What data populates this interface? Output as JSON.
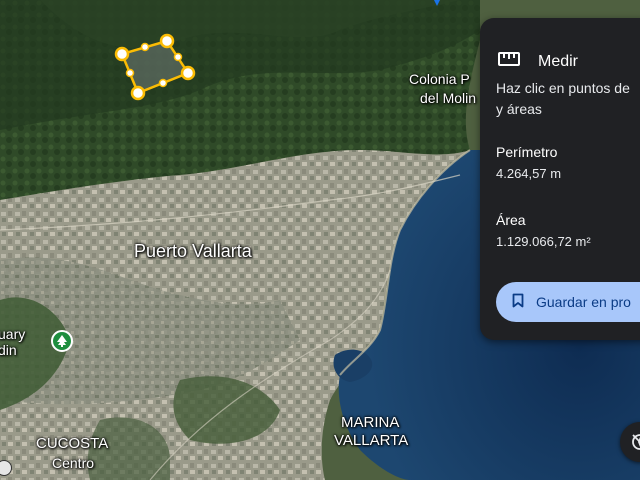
{
  "map": {
    "labels": {
      "city": "Puerto Vallarta",
      "colonia_line1": "Colonia P",
      "colonia_line2": "del Molin",
      "marina_line1": "MARINA",
      "marina_line2": "VALLARTA",
      "cucosta": "CUCOSTA",
      "centro": "Centro",
      "park_line1": "uary",
      "park_line2": "din"
    },
    "icons": {
      "park": "park-tree-icon",
      "top_marker": "location-pin-icon",
      "small_marker": "place-marker-icon"
    },
    "measured_polygon_color": "#fbbc04"
  },
  "measure_panel": {
    "icon": "ruler-icon",
    "title": "Medir",
    "description_line1": "Haz clic en puntos de",
    "description_line2": "y áreas",
    "perimeter_label": "Perímetro",
    "perimeter_value": "4.264,57 m",
    "area_label": "Área",
    "area_value": "1.129.066,72 m²",
    "save_label": "Guardar en pro",
    "save_icon": "bookmark-icon"
  },
  "controls": {
    "round_button_icon": "compass-off-icon"
  },
  "colors": {
    "panel_bg": "#202124",
    "button_bg": "#a8c7fa",
    "button_text": "#0b3c86",
    "water": "#15385f"
  }
}
